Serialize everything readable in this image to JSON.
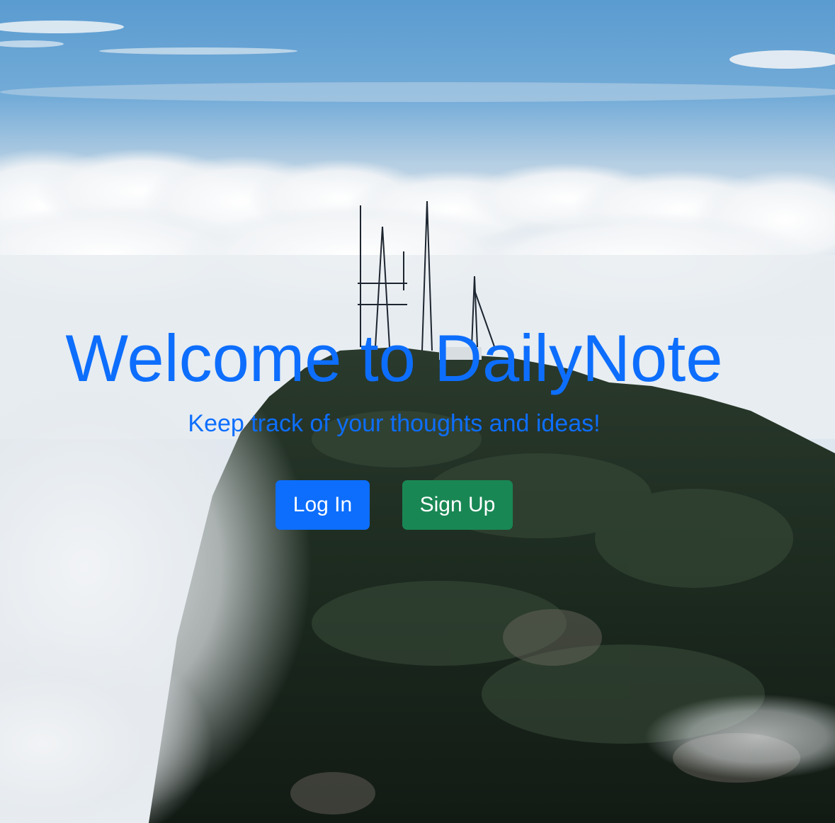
{
  "hero": {
    "title": "Welcome to DailyNote",
    "subtitle": "Keep track of your thoughts and ideas!",
    "background_image": "mountain-peak-with-antenna-towers-above-clouds"
  },
  "actions": {
    "login_label": "Log In",
    "signup_label": "Sign Up"
  },
  "colors": {
    "primary": "#0d6efd",
    "success": "#198754",
    "button_text": "#ffffff"
  }
}
